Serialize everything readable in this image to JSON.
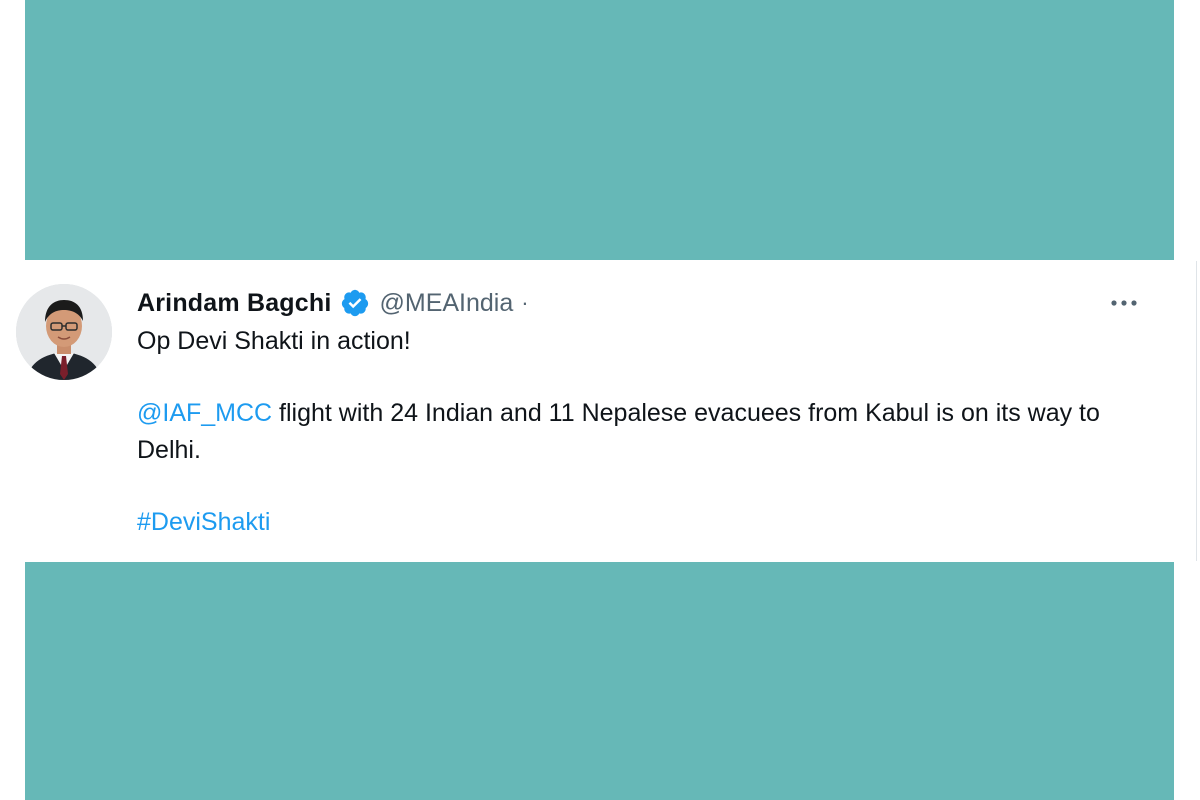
{
  "tweet": {
    "author_name": "Arindam Bagchi",
    "handle": "@MEAIndia",
    "separator": "·",
    "line1": "Op Devi Shakti in action!",
    "mention": "@IAF_MCC",
    "body_text": " flight with 24 Indian and 11 Nepalese evacuees from Kabul is on its way to Delhi.",
    "hashtag": "#DeviShakti"
  },
  "icons": {
    "verified": "verified-badge-icon",
    "more": "more-options-icon",
    "avatar": "profile-photo"
  },
  "colors": {
    "background_block": "#66b8b7",
    "link": "#1d9bf0",
    "verified": "#1d9bf0",
    "text_primary": "#0f1419",
    "text_secondary": "#536471"
  }
}
